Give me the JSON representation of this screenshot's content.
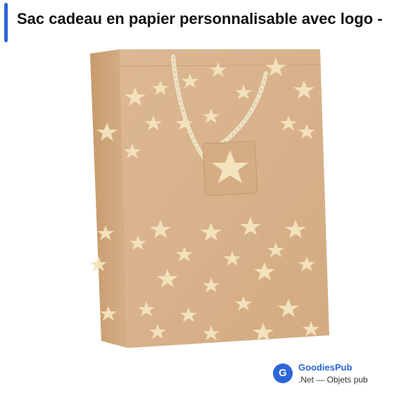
{
  "header": {
    "title": "Sac cadeau en papier personnalisable avec logo -"
  },
  "product": {
    "image_icon": "kraft-gift-bag-with-gold-stars",
    "colors": {
      "kraft": "#d9b38a",
      "kraft_dark": "#c99e72",
      "gold_star": "#f4e4bd",
      "rope": "#efe3c6"
    }
  },
  "source": {
    "icon_letter": "G",
    "name": "GoodiesPub",
    "subtitle": ".Net — Objets pub"
  },
  "colors": {
    "accent": "#2b66d9",
    "title_text": "#111111"
  }
}
